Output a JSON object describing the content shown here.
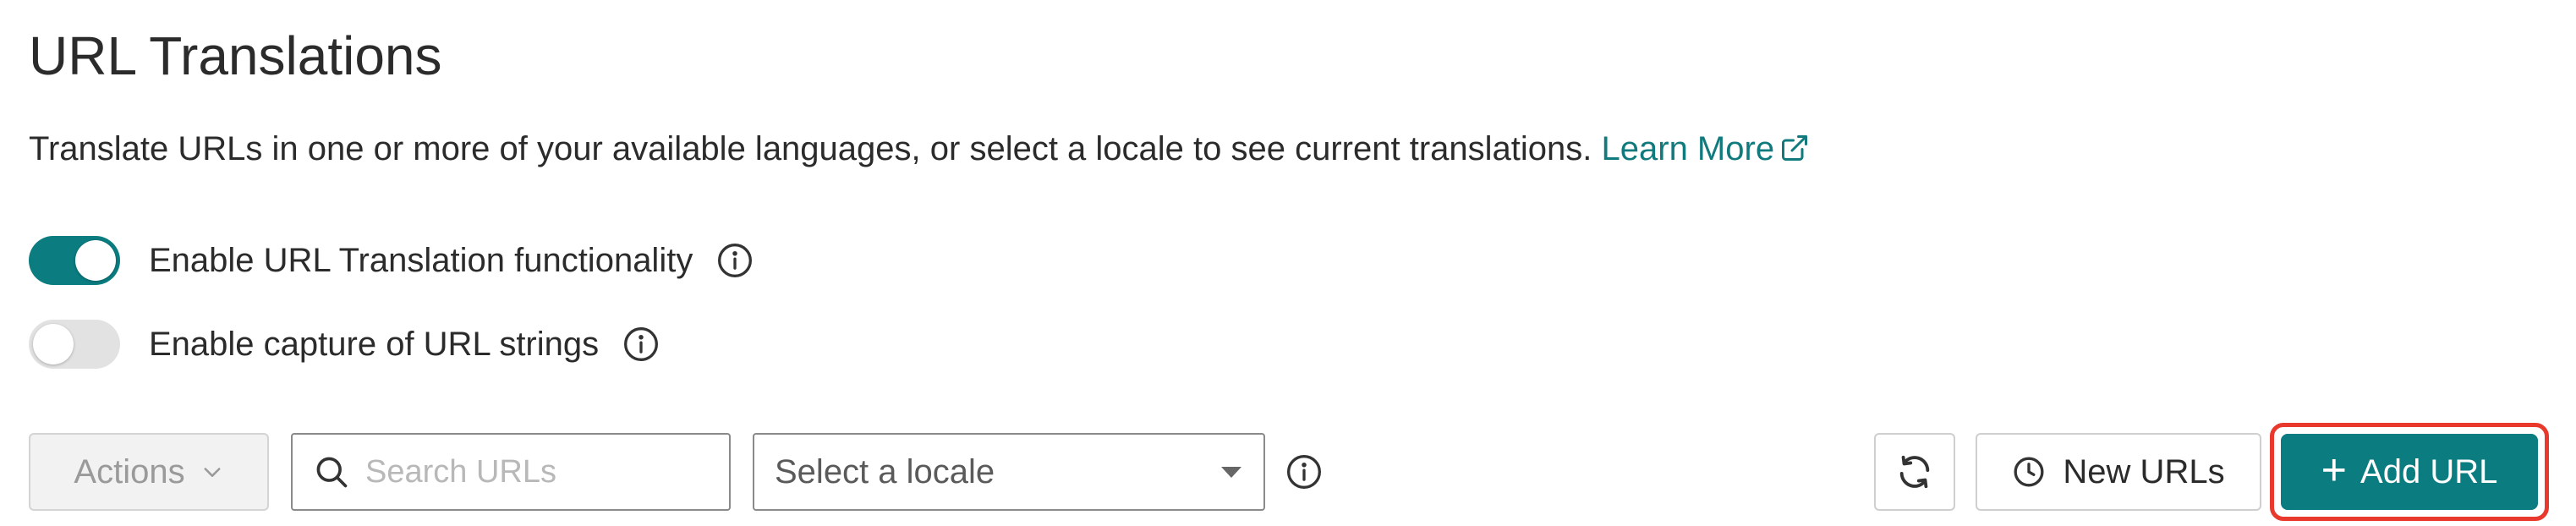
{
  "header": {
    "title": "URL Translations",
    "description": "Translate URLs in one or more of your available languages, or select a locale to see current translations.",
    "learn_more_label": "Learn More"
  },
  "toggles": [
    {
      "label": "Enable URL Translation functionality",
      "enabled": true
    },
    {
      "label": "Enable capture of URL strings",
      "enabled": false
    }
  ],
  "toolbar": {
    "actions_label": "Actions",
    "search_placeholder": "Search URLs",
    "search_value": "",
    "locale_placeholder": "Select a locale",
    "new_urls_label": "New URLs",
    "add_url_label": "Add URL",
    "add_url_icon": "+"
  },
  "colors": {
    "accent": "#0b7c80",
    "link": "#117a7d",
    "highlight": "#e8392c"
  },
  "icons": {
    "external": "external-link-icon",
    "info": "info-icon",
    "search": "search-icon",
    "chevron": "chevron-down-icon",
    "caret": "caret-down-icon",
    "refresh": "refresh-icon",
    "clock": "clock-icon",
    "plus": "plus-icon"
  }
}
